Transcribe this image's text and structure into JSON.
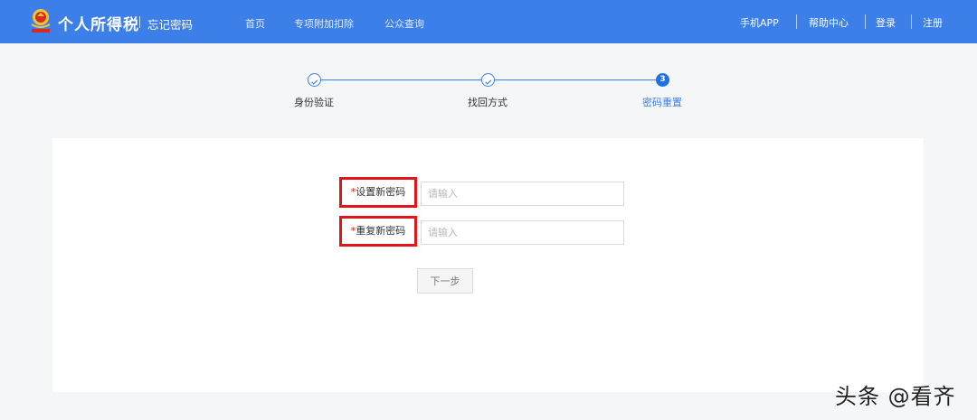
{
  "header": {
    "app_title": "个人所得税",
    "page_name": "忘记密码",
    "nav": [
      "首页",
      "专项附加扣除",
      "公众查询"
    ],
    "right_links": [
      "手机APP",
      "帮助中心",
      "登录",
      "注册"
    ],
    "logo_icon": "national-emblem-icon"
  },
  "steps": [
    {
      "label": "身份验证",
      "status": "done"
    },
    {
      "label": "找回方式",
      "status": "done"
    },
    {
      "label": "密码重置",
      "status": "current",
      "number": "3"
    }
  ],
  "form": {
    "required_mark": "*",
    "new_password_label": "设置新密码",
    "new_password_placeholder": "请输入",
    "new_password_value": "",
    "repeat_password_label": "重复新密码",
    "repeat_password_placeholder": "请输入",
    "repeat_password_value": "",
    "next_button": "下一步"
  },
  "watermark": "头条 @看齐",
  "colors": {
    "header_bg": "#3c7fe9",
    "accent": "#3c7fe9",
    "highlight_border": "#e1161b",
    "page_bg": "#f5f6f8"
  }
}
